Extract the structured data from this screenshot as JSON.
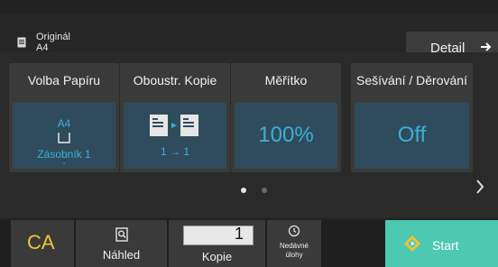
{
  "original": {
    "label": "Originál",
    "size": "A4"
  },
  "detail_button": {
    "label": "Detail"
  },
  "cards": [
    {
      "title": "Volba Papíru",
      "paper_size": "A4",
      "tray": "Zásobník 1",
      "tray_extra": "-"
    },
    {
      "title": "Oboustr. Kopie",
      "value": "1 → 1"
    },
    {
      "title": "Měřítko",
      "value": "100%"
    },
    {
      "title": "Sešívání / Děrování",
      "value": "Off"
    }
  ],
  "pagination": {
    "current_page": 1,
    "total_pages": 2
  },
  "bottom": {
    "ca_label": "CA",
    "preview_label": "Náhled",
    "copies_value": "1",
    "copies_label": "Kopie",
    "recent_label": "Nedávné\núlohy",
    "start_label": "Start"
  },
  "colors": {
    "accent": "#3ab0d8",
    "start": "#4cc9b0",
    "ca": "#f1c232"
  },
  "icons": [
    "original-icon",
    "arrow-right-icon",
    "paper-tray-icon",
    "duplex-icon",
    "chevron-right-icon",
    "preview-icon",
    "history-icon",
    "start-icon"
  ]
}
